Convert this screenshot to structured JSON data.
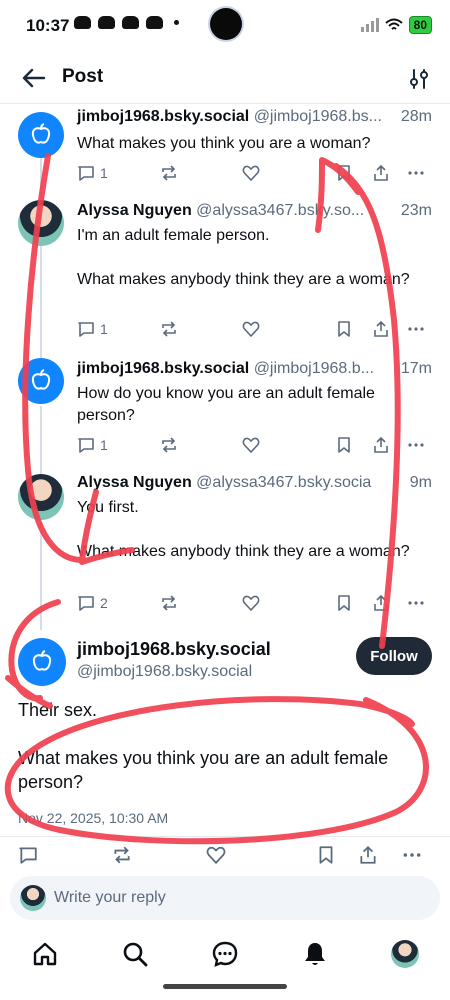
{
  "status_bar": {
    "time": "10:37",
    "battery": "80"
  },
  "header": {
    "title": "Post"
  },
  "thread": [
    {
      "name": "jimboj1968.bsky.social",
      "handle": "@jimboj1968.bs...",
      "time": "28m",
      "body": "What makes you think you are a woman?",
      "replies": "1"
    },
    {
      "name": "Alyssa Nguyen",
      "handle": "@alyssa3467.bsky.so...",
      "time": "23m",
      "body": "I'm an adult female person.\n\nWhat makes anybody think they are a woman?",
      "replies": "1"
    },
    {
      "name": "jimboj1968.bsky.social",
      "handle": "@jimboj1968.b...",
      "time": "17m",
      "body": "How do you know you are an adult female person?",
      "replies": "1"
    },
    {
      "name": "Alyssa Nguyen",
      "handle": "@alyssa3467.bsky.socia",
      "time": "9m",
      "body": "You first.\n\nWhat makes anybody think they are a woman?",
      "replies": "2"
    }
  ],
  "main_post": {
    "name": "jimboj1968.bsky.social",
    "handle": "@jimboj1968.bsky.social",
    "follow_label": "Follow",
    "body": "Their sex.\n\nWhat makes you think you are an adult female person?",
    "date": "Nov 22, 2025, 10:30 AM"
  },
  "reply_bar": {
    "placeholder": "Write your reply"
  },
  "colors": {
    "accent": "#1185fe",
    "annotation": "#f0404f",
    "follow_bg": "#1f2a36"
  },
  "icons": [
    "back-arrow-icon",
    "filter-icon",
    "reply-icon",
    "repost-icon",
    "like-icon",
    "bookmark-icon",
    "share-icon",
    "more-icon",
    "home-icon",
    "search-icon",
    "chat-icon",
    "bell-icon"
  ]
}
